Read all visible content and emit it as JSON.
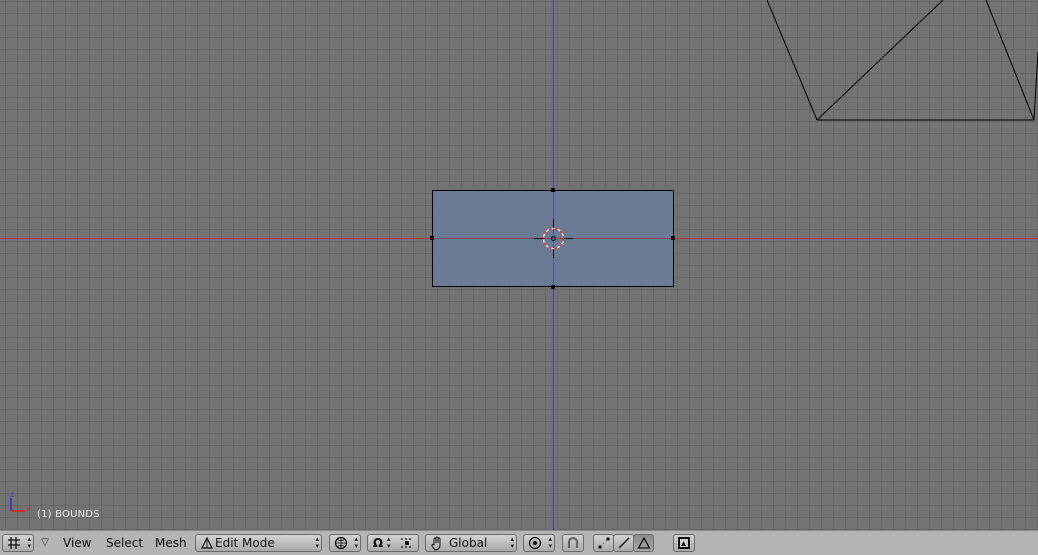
{
  "viewport": {
    "view_label": "(1) BOUNDS",
    "colors": {
      "background": "#737373",
      "grid": "#5f5f5f",
      "x_axis": "#b43232",
      "z_axis": "#3c3cc8",
      "selected_face": "#6a7b98",
      "edge": "#000000",
      "cursor": "#ff2020"
    },
    "axis_icon": {
      "up": "z",
      "right": "x"
    }
  },
  "header": {
    "window_type_icon": "grid-icon",
    "menus": [
      "View",
      "Select",
      "Mesh"
    ],
    "mode": {
      "label": "Edit Mode",
      "icon": "edit-mode-icon"
    },
    "draw_type_icon": "solid-draw-icon",
    "pivot_icon": "pivot-icon",
    "transform_orientation": {
      "label": "Global",
      "icon": "hand-manipulator-icon"
    },
    "proportional_edit_icon": "proportional-edit-icon",
    "snap_icon": "snap-magnet-icon",
    "select_mode_icons": [
      "vertex-select-icon",
      "edge-select-icon",
      "face-select-icon"
    ],
    "render_icon": "render-icon"
  }
}
